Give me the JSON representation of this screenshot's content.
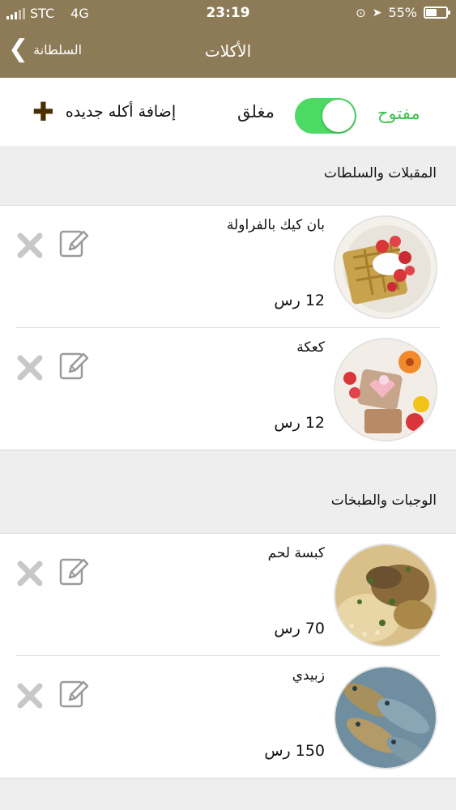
{
  "status": {
    "carrier": "STC",
    "network": "4G",
    "time": "23:19",
    "battery": "55%",
    "battery_level": 0.55
  },
  "nav": {
    "back_label": "السلطانة",
    "title": "الأكلات"
  },
  "toolbar": {
    "add_label": "إضافة أكله جديده",
    "closed_label": "مغلق",
    "open_label": "مفتوح",
    "toggle_on": true
  },
  "sections": [
    {
      "title": "المقبلات والسلطات",
      "items": [
        {
          "name": "بان كيك بالفراولة",
          "price": "12 رس"
        },
        {
          "name": "كعكة",
          "price": "12 رس"
        }
      ]
    },
    {
      "title": "الوجبات والطبخات",
      "items": [
        {
          "name": "كبسة لحم",
          "price": "70 رس"
        },
        {
          "name": "زبيدي",
          "price": "150 رس"
        }
      ]
    }
  ],
  "colors": {
    "nav": "#8c7b56",
    "toggle": "#4cd964",
    "open_text": "#3cc24c"
  }
}
